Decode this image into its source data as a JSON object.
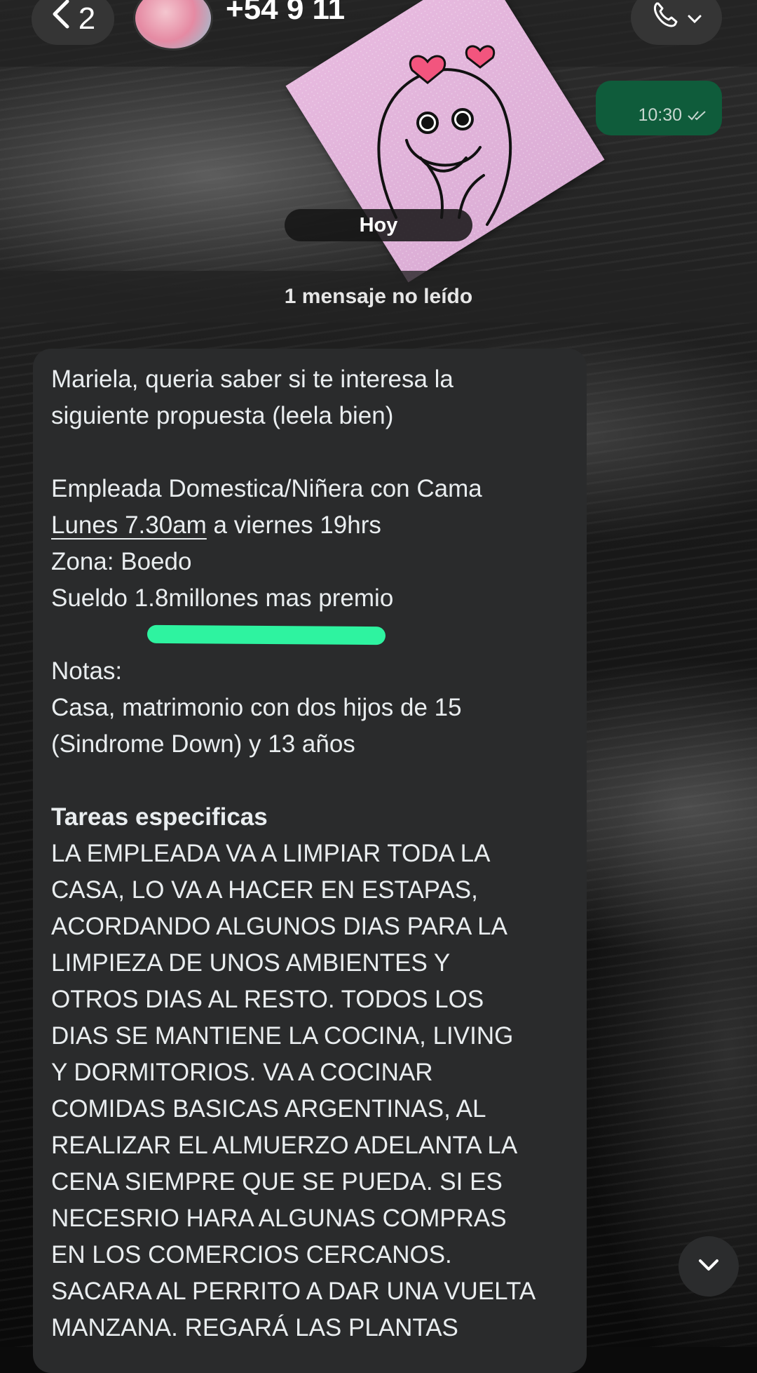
{
  "header": {
    "back_count": "2",
    "contact_name": "+54 9 11",
    "back_icon": "chevron-left-icon",
    "call_icon": "phone-icon"
  },
  "outgoing_message": {
    "time": "10:30",
    "status_icon": "double-check-icon"
  },
  "date_chip": "Hoy",
  "unread_banner": "1 mensaje no leído",
  "incoming_message": {
    "intro_1": "Mariela, queria saber si te interesa la",
    "intro_2": "siguiente propuesta (leela bien)",
    "job_title": "Empleada Domestica/Niñera con Cama",
    "schedule_link": "Lunes 7.30am",
    "schedule_rest": " a viernes 19hrs",
    "zone": "Zona: Boedo",
    "salary": "Sueldo 1.8millones mas premio",
    "notes_title": "Notas:",
    "notes_1": "Casa, matrimonio con dos hijos de 15",
    "notes_2": "(Sindrome Down) y 13 años",
    "tasks_title": "Tareas especificas",
    "tasks_lines": [
      "LA EMPLEADA VA A LIMPIAR TODA LA",
      "CASA, LO VA A HACER EN ESTAPAS,",
      "ACORDANDO ALGUNOS DIAS PARA LA",
      "LIMPIEZA DE UNOS AMBIENTES Y",
      "OTROS DIAS AL RESTO. TODOS LOS",
      "DIAS SE MANTIENE LA COCINA, LIVING",
      "Y DORMITORIOS. VA A COCINAR",
      "COMIDAS BASICAS ARGENTINAS, AL",
      "REALIZAR EL ALMUERZO ADELANTA LA",
      "CENA SIEMPRE QUE SE PUEDA. SI ES",
      "NECESRIO HARA ALGUNAS COMPRAS",
      "EN LOS COMERCIOS CERCANOS.",
      "SACARA AL PERRITO A DAR UNA VUELTA",
      "MANZANA. REGARÁ LAS PLANTAS"
    ]
  },
  "colors": {
    "highlight": "#2ef3a0",
    "outgoing_bubble": "#0f5c3b",
    "incoming_bubble": "#2a2b2c"
  }
}
